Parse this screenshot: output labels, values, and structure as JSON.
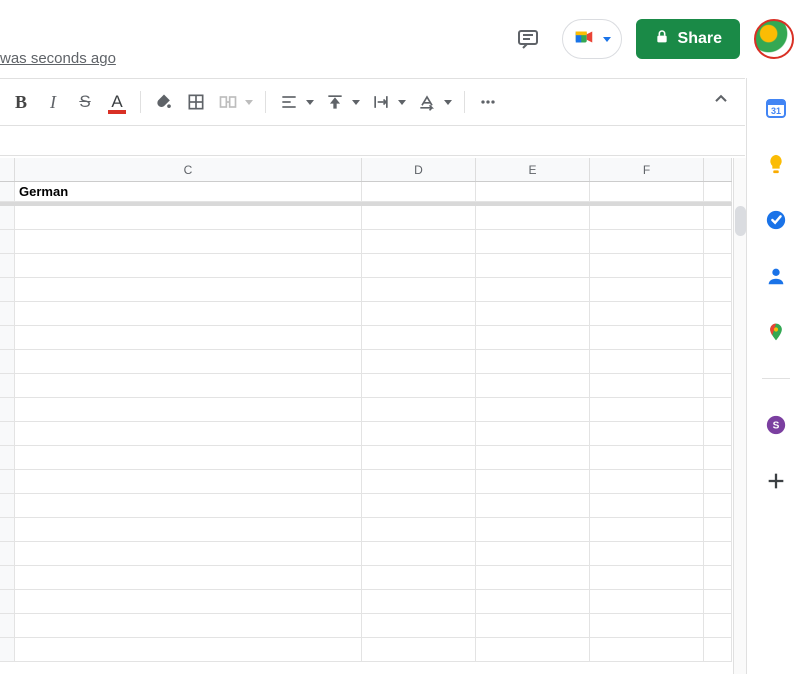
{
  "header": {
    "last_edit_text": "was seconds ago",
    "share_label": "Share"
  },
  "toolbar": {
    "bold_glyph": "B",
    "italic_glyph": "I",
    "strike_glyph": "S",
    "textcolor_glyph": "A"
  },
  "grid": {
    "columns": [
      "C",
      "D",
      "E",
      "F"
    ],
    "first_row": {
      "C": "German",
      "D": "",
      "E": "",
      "F": ""
    },
    "blank_row_count": 19
  },
  "sidepanel": {
    "calendar_day": "31"
  }
}
